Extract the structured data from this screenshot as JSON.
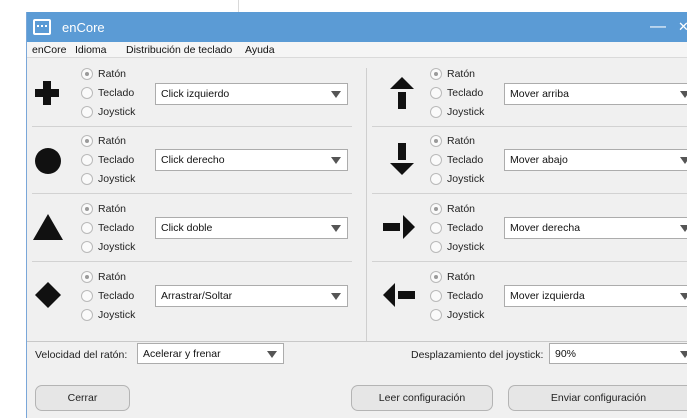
{
  "window": {
    "title": "enCore",
    "minimize_glyph": "—",
    "close_glyph": "✕"
  },
  "menu": {
    "items": [
      "enCore",
      "Idioma",
      "Distribución de teclado",
      "Ayuda"
    ]
  },
  "options": {
    "mouse": "Ratón",
    "keyboard": "Teclado",
    "joystick": "Joystick"
  },
  "left_rows": [
    {
      "icon": "cross-icon",
      "selected_input": "Ratón",
      "action": "Click izquierdo"
    },
    {
      "icon": "circle-icon",
      "selected_input": "Ratón",
      "action": "Click derecho"
    },
    {
      "icon": "triangle-icon",
      "selected_input": "Ratón",
      "action": "Click doble"
    },
    {
      "icon": "diamond-icon",
      "selected_input": "Ratón",
      "action": "Arrastrar/Soltar"
    }
  ],
  "right_rows": [
    {
      "icon": "arrow-up-icon",
      "selected_input": "Ratón",
      "action": "Mover arriba"
    },
    {
      "icon": "arrow-down-icon",
      "selected_input": "Ratón",
      "action": "Mover abajo"
    },
    {
      "icon": "arrow-right-icon",
      "selected_input": "Ratón",
      "action": "Mover derecha"
    },
    {
      "icon": "arrow-left-icon",
      "selected_input": "Ratón",
      "action": "Mover izquierda"
    }
  ],
  "mouse_speed": {
    "label": "Velocidad del ratón:",
    "value": "Acelerar y frenar"
  },
  "joystick_offset": {
    "label": "Desplazamiento del joystick:",
    "value": "90%"
  },
  "buttons": {
    "close": "Cerrar",
    "read_config": "Leer configuración",
    "send_config": "Enviar configuración"
  },
  "colors": {
    "titlebar": "#5b9bd5",
    "window_bg": "#f0f0f0",
    "icon_fill": "#111111"
  }
}
